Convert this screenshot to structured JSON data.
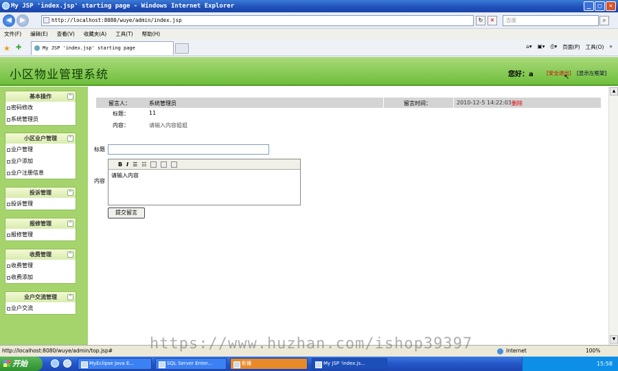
{
  "window": {
    "title": "My JSP 'index.jsp' starting page - Windows Internet Explorer",
    "min_label": "_",
    "max_label": "□",
    "close_label": "✕"
  },
  "browser": {
    "back_label": "◀",
    "forward_label": "▶",
    "address": "http://localhost:8080/wuye/admin/index.jsp",
    "search_placeholder": "百度",
    "menu": [
      "文件(F)",
      "编辑(E)",
      "查看(V)",
      "收藏夹(A)",
      "工具(T)",
      "帮助(H)"
    ],
    "tab_title": "My JSP 'index.jsp' starting page",
    "page_tool": "页面(P)",
    "tools_tool": "工具(O)"
  },
  "header": {
    "title": "小区物业管理系统",
    "greeting": "您好：a",
    "logout": "[安全退出]",
    "toggle": "[显示左框架]"
  },
  "sidebar": {
    "groups": [
      {
        "title": "基本操作",
        "items": [
          "密码修改",
          "系统管理员"
        ]
      },
      {
        "title": "小区业户管理",
        "items": [
          "业户管理",
          "业户添加",
          "业户注册信息"
        ]
      },
      {
        "title": "投诉管理",
        "items": [
          "投诉管理"
        ]
      },
      {
        "title": "报修管理",
        "items": [
          "报修管理"
        ]
      },
      {
        "title": "收费管理",
        "items": [
          "收费管理",
          "收费添加"
        ]
      },
      {
        "title": "业户交流管理",
        "items": [
          "业户交流"
        ]
      }
    ]
  },
  "message": {
    "author_label": "留言人：",
    "author": "系统管理员",
    "time_label": "留言时间：",
    "time": "2010-12-5 14:22:03",
    "delete": "删除",
    "title_label": "标题：",
    "title": "11",
    "content_label": "内容：",
    "content": "请输入内容姐姐"
  },
  "form": {
    "title_label": "标题",
    "content_label": "内容",
    "editor_text": "请输入内容",
    "submit": "提交留言"
  },
  "status": {
    "url": "http://localhost:8080/wuye/admin/top.jsp#",
    "zone": "Internet",
    "zoom": "100%",
    "watermark": "https://www.huzhan.com/ishop39397"
  },
  "taskbar": {
    "start": "开始",
    "tasks": [
      "MyEclipse Java E...",
      "SQL Server Enter...",
      "影播",
      "My JSP 'index.js..."
    ],
    "clock": "15:58"
  }
}
